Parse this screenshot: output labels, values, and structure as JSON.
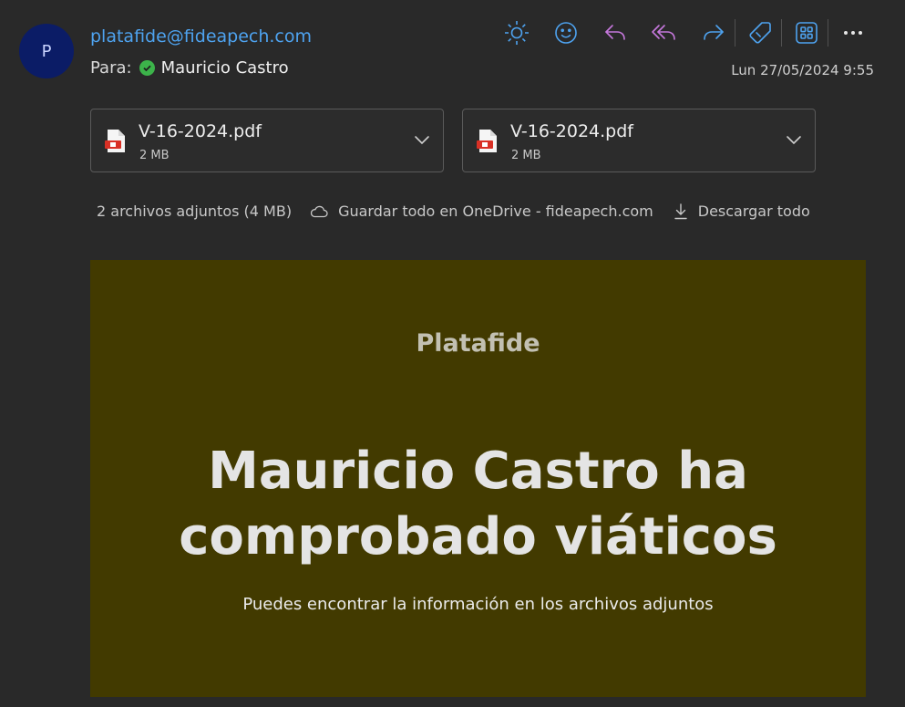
{
  "email": {
    "avatar_initial": "P",
    "sender": "platafide@fideapech.com",
    "to_label": "Para:",
    "recipient": "Mauricio Castro",
    "date": "Lun 27/05/2024 9:55"
  },
  "toolbar": {
    "icons": [
      "brightness-icon",
      "emoji-icon",
      "reply-icon",
      "reply-all-icon",
      "forward-icon",
      "tag-icon",
      "apps-icon",
      "more-icon"
    ],
    "colors": {
      "blue": "#4ea3f0",
      "purple": "#c678dd"
    }
  },
  "attachments": {
    "files": [
      {
        "name": "V-16-2024.pdf",
        "size": "2 MB"
      },
      {
        "name": "V-16-2024.pdf",
        "size": "2 MB"
      }
    ],
    "summary": "2 archivos adjuntos (4 MB)",
    "save_onedrive": "Guardar todo en OneDrive - fideapech.com",
    "download_all": "Descargar todo"
  },
  "body": {
    "brand": "Platafide",
    "headline_line1": "Mauricio Castro ha",
    "headline_line2": "comprobado viáticos",
    "subtext": "Puedes encontrar la información en los archivos adjuntos",
    "banner_color": "#423a00"
  }
}
